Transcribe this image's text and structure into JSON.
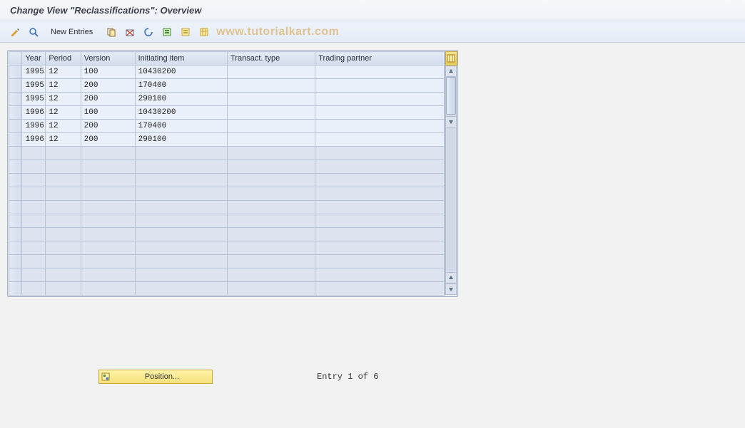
{
  "title": "Change View \"Reclassifications\": Overview",
  "toolbar": {
    "new_entries": "New Entries"
  },
  "watermark": "www.tutorialkart.com",
  "columns": {
    "year": "Year",
    "period": "Period",
    "version": "Version",
    "item": "Initiating item",
    "ttype": "Transact. type",
    "partner": "Trading partner"
  },
  "rows": [
    {
      "year": "1995",
      "period": "12",
      "version": "100",
      "item": "10430200",
      "ttype": "",
      "partner": ""
    },
    {
      "year": "1995",
      "period": "12",
      "version": "200",
      "item": "170400",
      "ttype": "",
      "partner": ""
    },
    {
      "year": "1995",
      "period": "12",
      "version": "200",
      "item": "290100",
      "ttype": "",
      "partner": ""
    },
    {
      "year": "1996",
      "period": "12",
      "version": "100",
      "item": "10430200",
      "ttype": "",
      "partner": ""
    },
    {
      "year": "1996",
      "period": "12",
      "version": "200",
      "item": "170400",
      "ttype": "",
      "partner": ""
    },
    {
      "year": "1996",
      "period": "12",
      "version": "200",
      "item": "290100",
      "ttype": "",
      "partner": ""
    }
  ],
  "empty_rows": 11,
  "footer": {
    "position_label": "Position...",
    "entry_text": "Entry 1 of 6"
  }
}
